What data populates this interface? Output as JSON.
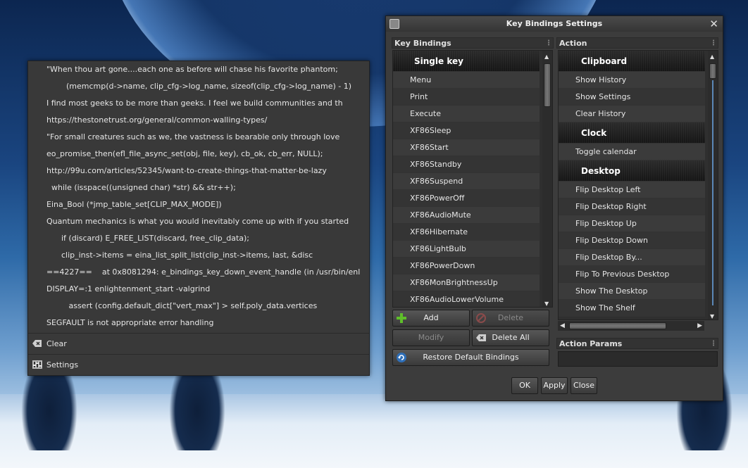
{
  "clipboard": {
    "items": [
      "\"When thou art gone....each one as before will chase his favorite phantom;",
      "        (memcmp(d->name, clip_cfg->log_name, sizeof(clip_cfg->log_name) - 1)",
      "I find most geeks to be more than geeks. I feel we build communities and th",
      "https://thestonetrust.org/general/common-walling-types/",
      "\"For small creatures such as we, the vastness is bearable only through love",
      "eo_promise_then(efl_file_async_set(obj, file, key), cb_ok, cb_err, NULL);",
      "http://99u.com/articles/52345/want-to-create-things-that-matter-be-lazy",
      "  while (isspace((unsigned char) *str) && str++);",
      "Eina_Bool (*jmp_table_set[CLIP_MAX_MODE])",
      "Quantum mechanics is what you would inevitably come up with if you started",
      "      if (discard) E_FREE_LIST(discard, free_clip_data);",
      "      clip_inst->items = eina_list_split_list(clip_inst->items, last, &disc",
      "==4227==    at 0x8081294: e_bindings_key_down_event_handle (in /usr/bin/enl",
      "DISPLAY=:1 enlightenment_start -valgrind",
      "         assert (config.default_dict[\"vert_max\"] > self.poly_data.vertices",
      "SEGFAULT is not appropriate error handling"
    ],
    "clear_label": "Clear",
    "settings_label": "Settings"
  },
  "dialog": {
    "title": "Key Bindings Settings",
    "key_bindings_label": "Key Bindings",
    "action_label": "Action",
    "action_params_label": "Action Params",
    "key_list_header": "Single key",
    "keys": [
      "Menu",
      "Print",
      "Execute",
      "XF86Sleep",
      "XF86Start",
      "XF86Standby",
      "XF86Suspend",
      "XF86PowerOff",
      "XF86AudioMute",
      "XF86Hibernate",
      "XF86LightBulb",
      "XF86PowerDown",
      "XF86MonBrightnessUp",
      "XF86AudioLowerVolume"
    ],
    "action_groups": [
      {
        "header": "Clipboard",
        "items": [
          "Show History",
          "Show Settings",
          "Clear History"
        ]
      },
      {
        "header": "Clock",
        "items": [
          "Toggle calendar"
        ]
      },
      {
        "header": "Desktop",
        "items": [
          "Flip Desktop Left",
          "Flip Desktop Right",
          "Flip Desktop Up",
          "Flip Desktop Down",
          "Flip Desktop By...",
          "Flip To Previous Desktop",
          "Show The Desktop",
          "Show The Shelf"
        ]
      }
    ],
    "buttons": {
      "add": "Add",
      "delete": "Delete",
      "modify": "Modify",
      "delete_all": "Delete All",
      "restore": "Restore Default Bindings",
      "ok": "OK",
      "apply": "Apply",
      "close": "Close"
    },
    "action_params_value": ""
  }
}
